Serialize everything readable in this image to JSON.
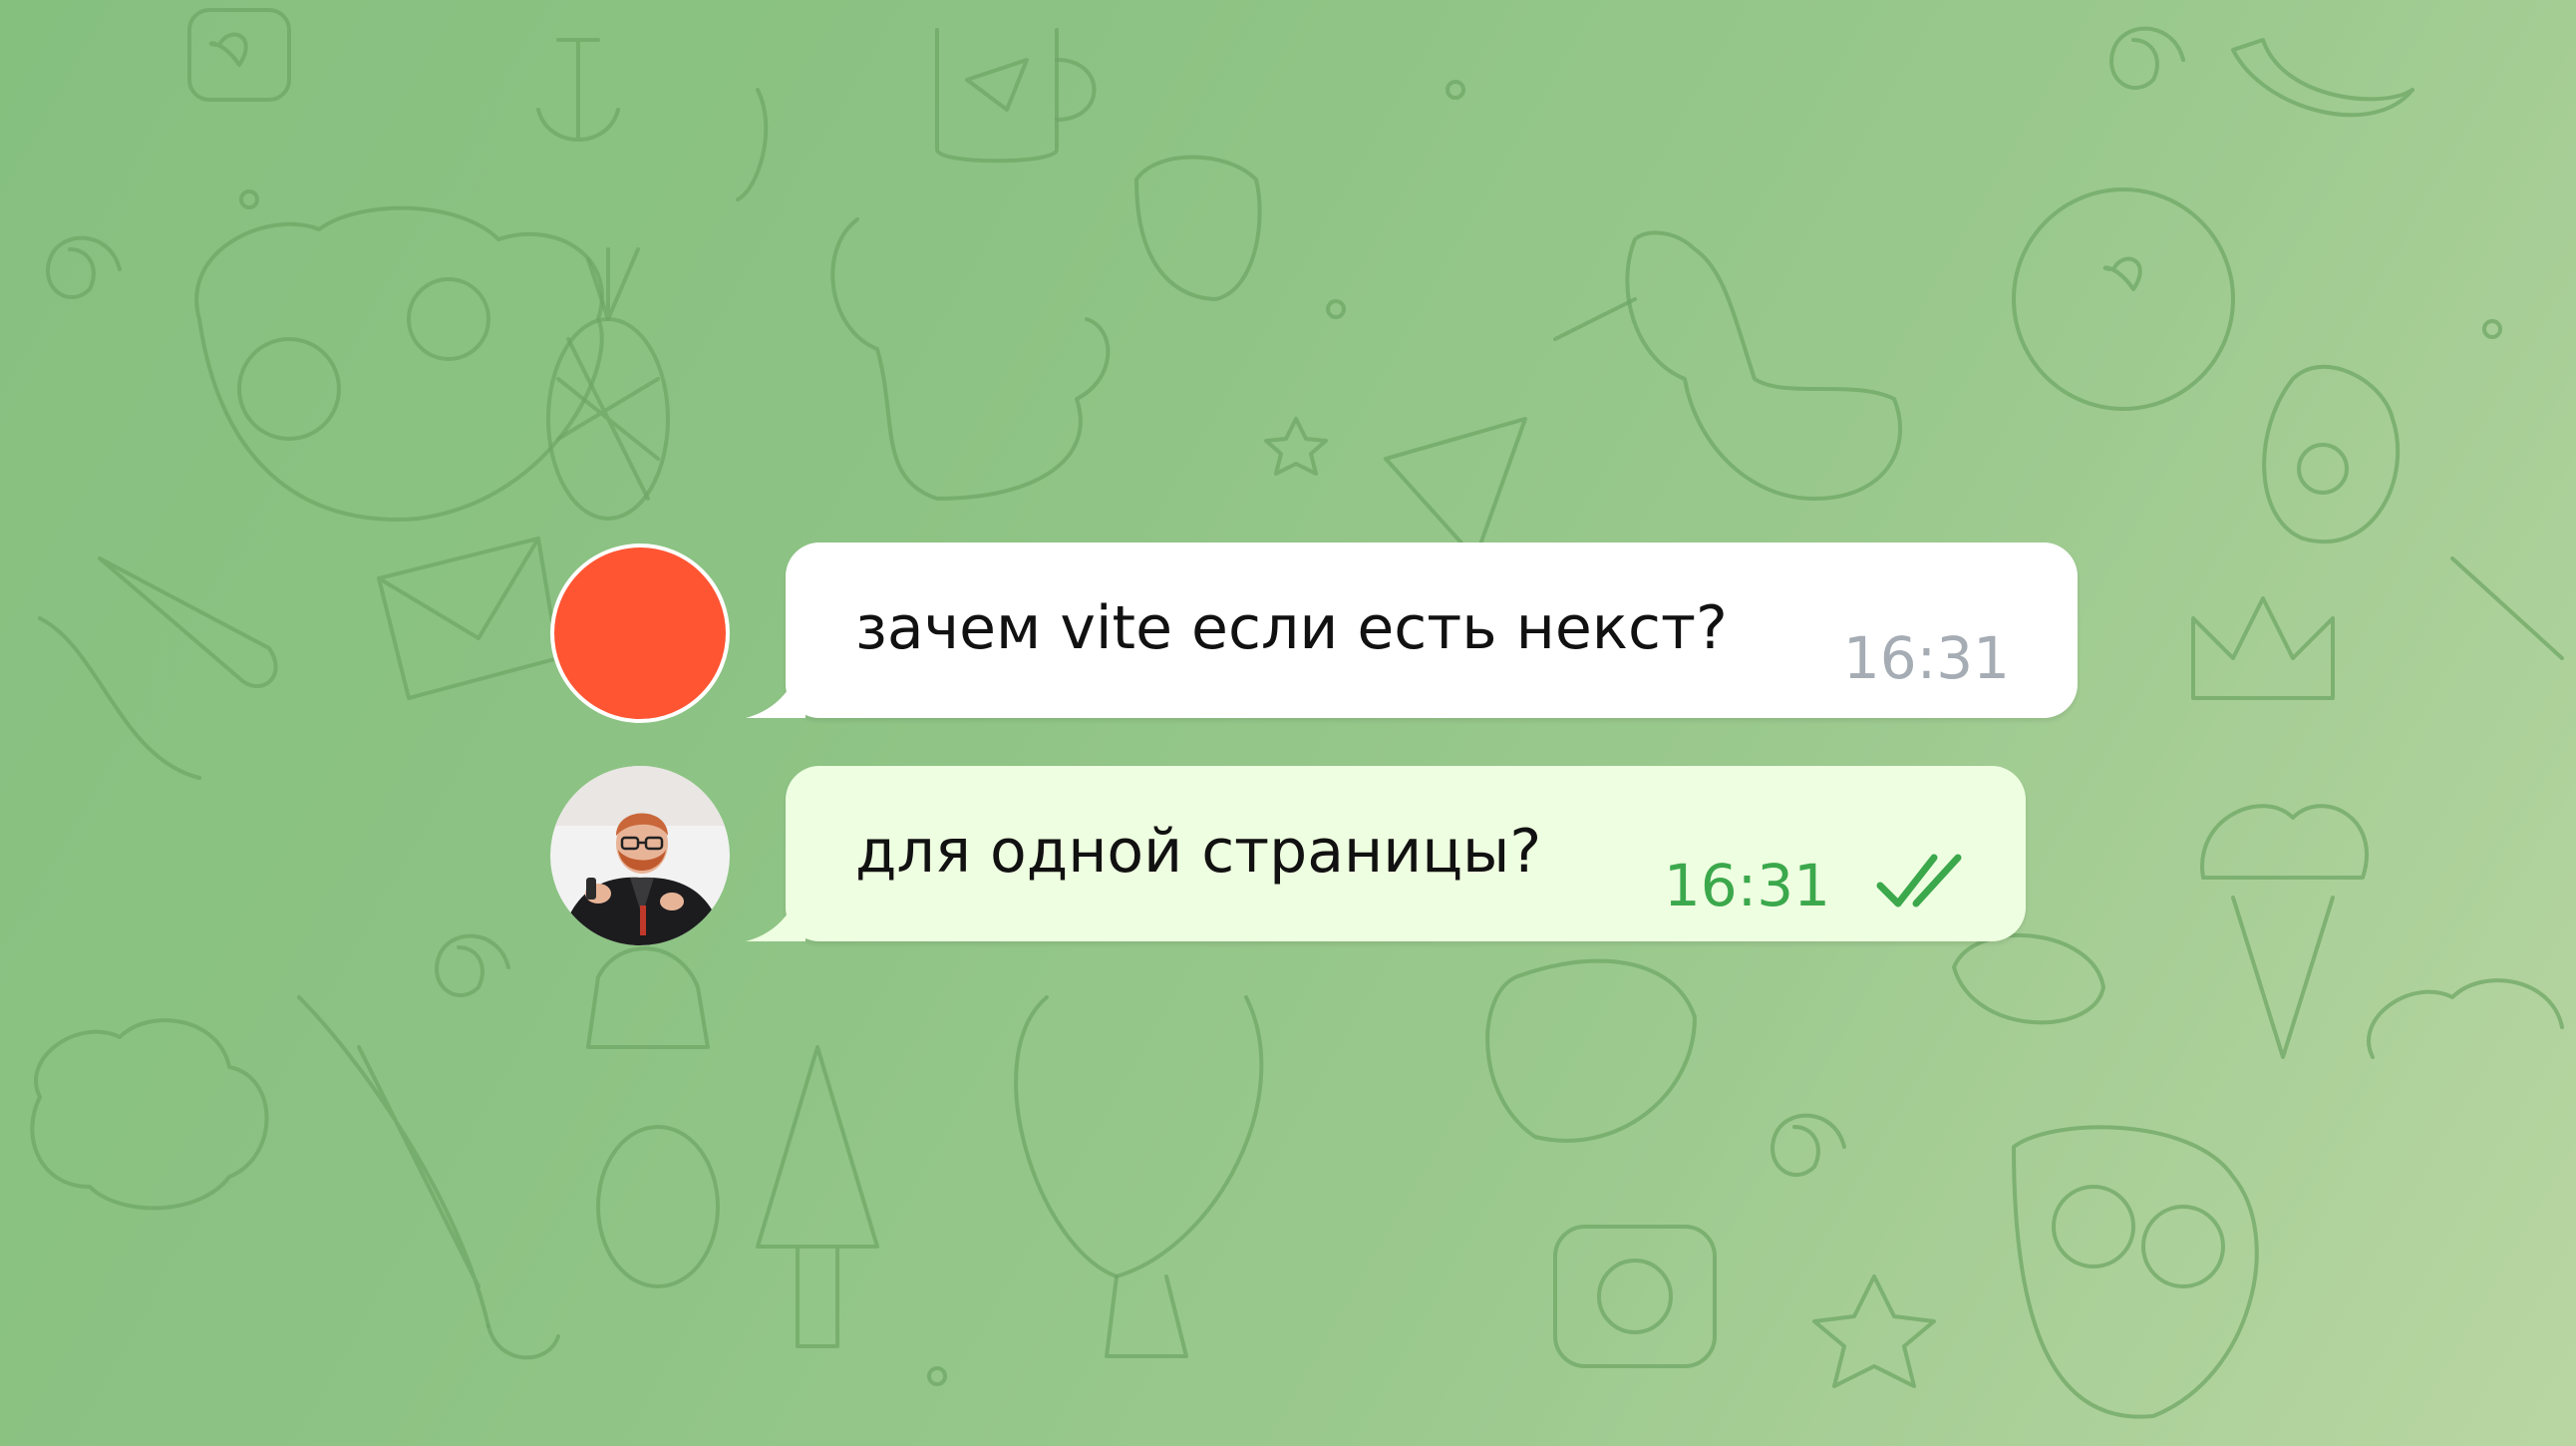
{
  "chat": {
    "messages": [
      {
        "sender": "red-avatar-user",
        "text": "зачем vite если есть некст?",
        "time": "16:31",
        "direction": "incoming"
      },
      {
        "sender": "photo-avatar-user",
        "text": "для одной страницы?",
        "time": "16:31",
        "direction": "outgoing",
        "status_icon": "double-check-icon"
      }
    ]
  },
  "colors": {
    "wallpaper": "#8dc384",
    "doodle_stroke": "#6fa766",
    "incoming_bubble": "#ffffff",
    "outgoing_bubble": "#eefee0",
    "red_avatar": "#ff5533",
    "incoming_time": "#a5acb4",
    "outgoing_time": "#3ba84c"
  }
}
